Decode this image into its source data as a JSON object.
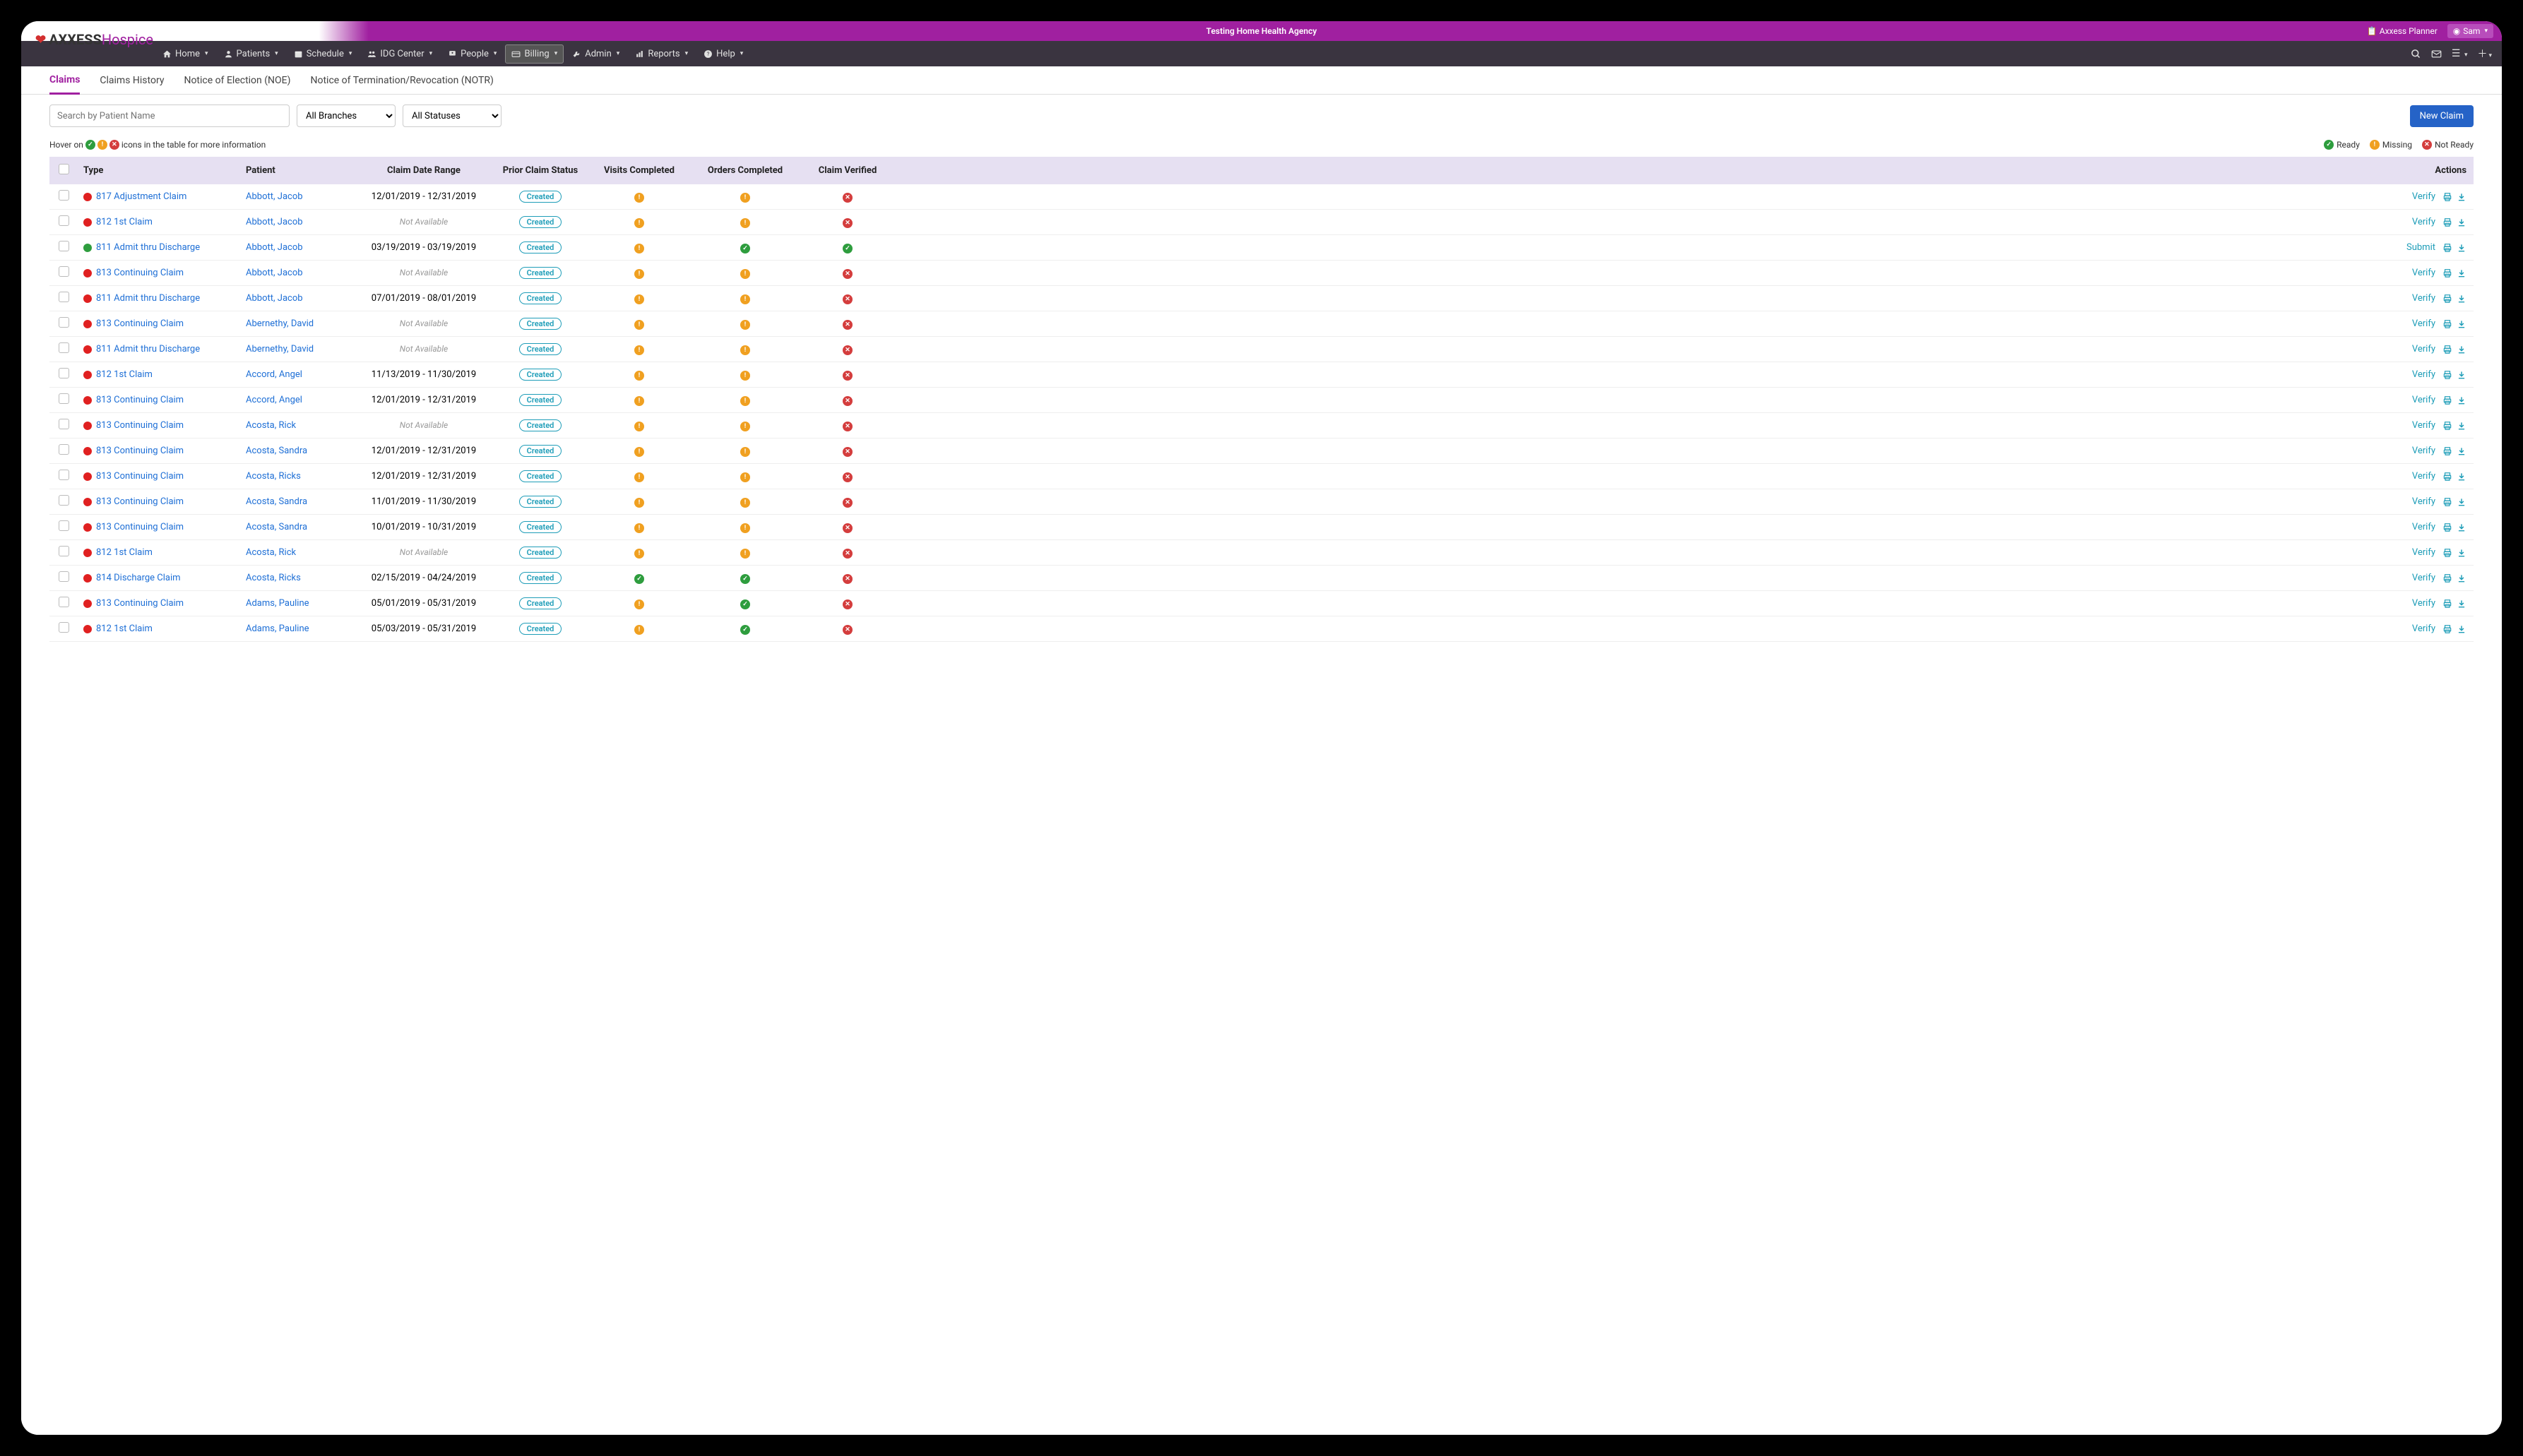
{
  "topbar": {
    "title": "Testing Home Health Agency",
    "planner": "Axxess Planner",
    "user": "Sam"
  },
  "logo": {
    "brand": "AXXESS",
    "product": "Hospice"
  },
  "nav": [
    {
      "icon": "home",
      "label": "Home"
    },
    {
      "icon": "user",
      "label": "Patients"
    },
    {
      "icon": "calendar",
      "label": "Schedule"
    },
    {
      "icon": "group",
      "label": "IDG Center"
    },
    {
      "icon": "people",
      "label": "People"
    },
    {
      "icon": "card",
      "label": "Billing",
      "active": true
    },
    {
      "icon": "wrench",
      "label": "Admin"
    },
    {
      "icon": "chart",
      "label": "Reports"
    },
    {
      "icon": "help",
      "label": "Help"
    }
  ],
  "subtabs": [
    {
      "label": "Claims",
      "active": true
    },
    {
      "label": "Claims History"
    },
    {
      "label": "Notice of Election (NOE)"
    },
    {
      "label": "Notice of Termination/Revocation (NOTR)"
    }
  ],
  "filters": {
    "search_placeholder": "Search by Patient Name",
    "branch": "All Branches",
    "status": "All Statuses",
    "new_claim": "New Claim"
  },
  "hint": {
    "prefix": "Hover on",
    "suffix": "icons in the table for more information"
  },
  "legend": {
    "ready": "Ready",
    "missing": "Missing",
    "notready": "Not Ready"
  },
  "columns": {
    "type": "Type",
    "patient": "Patient",
    "date_range": "Claim Date Range",
    "prior_status": "Prior Claim Status",
    "visits": "Visits Completed",
    "orders": "Orders Completed",
    "verified": "Claim Verified",
    "actions": "Actions"
  },
  "actions": {
    "verify": "Verify",
    "submit": "Submit"
  },
  "badge_created": "Created",
  "na": "Not Available",
  "rows": [
    {
      "dot": "red",
      "type": "817 Adjustment Claim",
      "patient": "Abbott, Jacob",
      "date": "12/01/2019 - 12/31/2019",
      "prior": "Created",
      "visits": "missing",
      "orders": "missing",
      "verified": "notready",
      "action": "Verify"
    },
    {
      "dot": "red",
      "type": "812 1st Claim",
      "patient": "Abbott, Jacob",
      "date": "",
      "prior": "Created",
      "visits": "missing",
      "orders": "missing",
      "verified": "notready",
      "action": "Verify"
    },
    {
      "dot": "green",
      "type": "811 Admit thru Discharge",
      "patient": "Abbott, Jacob",
      "date": "03/19/2019 - 03/19/2019",
      "prior": "Created",
      "visits": "missing",
      "orders": "ready",
      "verified": "ready",
      "action": "Submit"
    },
    {
      "dot": "red",
      "type": "813 Continuing Claim",
      "patient": "Abbott, Jacob",
      "date": "",
      "prior": "Created",
      "visits": "missing",
      "orders": "missing",
      "verified": "notready",
      "action": "Verify"
    },
    {
      "dot": "red",
      "type": "811 Admit thru Discharge",
      "patient": "Abbott, Jacob",
      "date": "07/01/2019 - 08/01/2019",
      "prior": "Created",
      "visits": "missing",
      "orders": "missing",
      "verified": "notready",
      "action": "Verify"
    },
    {
      "dot": "red",
      "type": "813 Continuing Claim",
      "patient": "Abernethy, David",
      "date": "",
      "prior": "Created",
      "visits": "missing",
      "orders": "missing",
      "verified": "notready",
      "action": "Verify"
    },
    {
      "dot": "red",
      "type": "811 Admit thru Discharge",
      "patient": "Abernethy, David",
      "date": "",
      "prior": "Created",
      "visits": "missing",
      "orders": "missing",
      "verified": "notready",
      "action": "Verify"
    },
    {
      "dot": "red",
      "type": "812 1st Claim",
      "patient": "Accord, Angel",
      "date": "11/13/2019 - 11/30/2019",
      "prior": "Created",
      "visits": "missing",
      "orders": "missing",
      "verified": "notready",
      "action": "Verify"
    },
    {
      "dot": "red",
      "type": "813 Continuing Claim",
      "patient": "Accord, Angel",
      "date": "12/01/2019 - 12/31/2019",
      "prior": "Created",
      "visits": "missing",
      "orders": "missing",
      "verified": "notready",
      "action": "Verify"
    },
    {
      "dot": "red",
      "type": "813 Continuing Claim",
      "patient": "Acosta, Rick",
      "date": "",
      "prior": "Created",
      "visits": "missing",
      "orders": "missing",
      "verified": "notready",
      "action": "Verify"
    },
    {
      "dot": "red",
      "type": "813 Continuing Claim",
      "patient": "Acosta, Sandra",
      "date": "12/01/2019 - 12/31/2019",
      "prior": "Created",
      "visits": "missing",
      "orders": "missing",
      "verified": "notready",
      "action": "Verify"
    },
    {
      "dot": "red",
      "type": "813 Continuing Claim",
      "patient": "Acosta, Ricks",
      "date": "12/01/2019 - 12/31/2019",
      "prior": "Created",
      "visits": "missing",
      "orders": "missing",
      "verified": "notready",
      "action": "Verify"
    },
    {
      "dot": "red",
      "type": "813 Continuing Claim",
      "patient": "Acosta, Sandra",
      "date": "11/01/2019 - 11/30/2019",
      "prior": "Created",
      "visits": "missing",
      "orders": "missing",
      "verified": "notready",
      "action": "Verify"
    },
    {
      "dot": "red",
      "type": "813 Continuing Claim",
      "patient": "Acosta, Sandra",
      "date": "10/01/2019 - 10/31/2019",
      "prior": "Created",
      "visits": "missing",
      "orders": "missing",
      "verified": "notready",
      "action": "Verify"
    },
    {
      "dot": "red",
      "type": "812 1st Claim",
      "patient": "Acosta, Rick",
      "date": "",
      "prior": "Created",
      "visits": "missing",
      "orders": "missing",
      "verified": "notready",
      "action": "Verify"
    },
    {
      "dot": "red",
      "type": "814 Discharge Claim",
      "patient": "Acosta, Ricks",
      "date": "02/15/2019 - 04/24/2019",
      "prior": "Created",
      "visits": "ready",
      "orders": "ready",
      "verified": "notready",
      "action": "Verify"
    },
    {
      "dot": "red",
      "type": "813 Continuing Claim",
      "patient": "Adams, Pauline",
      "date": "05/01/2019 - 05/31/2019",
      "prior": "Created",
      "visits": "missing",
      "orders": "ready",
      "verified": "notready",
      "action": "Verify"
    },
    {
      "dot": "red",
      "type": "812 1st Claim",
      "patient": "Adams, Pauline",
      "date": "05/03/2019 - 05/31/2019",
      "prior": "Created",
      "visits": "missing",
      "orders": "ready",
      "verified": "notready",
      "action": "Verify"
    }
  ]
}
